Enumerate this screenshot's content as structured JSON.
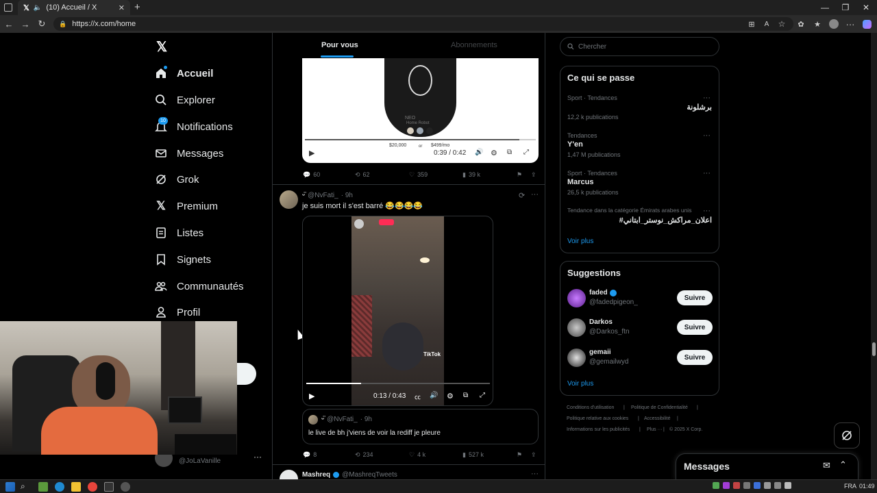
{
  "browser": {
    "tab_title": "(10) Accueil / X",
    "url": "https://x.com/home"
  },
  "sidebar": {
    "items": [
      {
        "label": "Accueil",
        "icon": "home-icon"
      },
      {
        "label": "Explorer",
        "icon": "search-icon"
      },
      {
        "label": "Notifications",
        "icon": "bell-icon",
        "badge": "10"
      },
      {
        "label": "Messages",
        "icon": "mail-icon"
      },
      {
        "label": "Grok",
        "icon": "grok-icon"
      },
      {
        "label": "Premium",
        "icon": "x-logo-icon"
      },
      {
        "label": "Listes",
        "icon": "list-icon"
      },
      {
        "label": "Signets",
        "icon": "bookmark-icon"
      },
      {
        "label": "Communautés",
        "icon": "communities-icon"
      },
      {
        "label": "Profil",
        "icon": "person-icon"
      }
    ],
    "account_handle": "@JoLaVanille"
  },
  "feed": {
    "tabs": [
      "Pour vous",
      "Abonnements"
    ],
    "post1": {
      "video_time": "0:39 / 0:42",
      "media_text": {
        "brand": "NEO",
        "subtitle": "Home Robot",
        "price1": "$20,000",
        "or": "or",
        "price2": "$499/mo"
      },
      "replies": "60",
      "reposts": "62",
      "likes": "359",
      "views": "39 k"
    },
    "post2": {
      "handle": "@NvFati_",
      "time": "· 9h",
      "text": "je suis mort il s'est barré 😂😂😂😂",
      "video_time": "0:13 / 0:43",
      "tiktok_label": "TikTok",
      "quote": {
        "handle": "@NvFati_",
        "time": "· 9h",
        "text": "le live de bh j'viens de voir la rediff je pleure"
      },
      "replies": "8",
      "reposts": "234",
      "likes": "4 k",
      "views": "527 k"
    },
    "post3": {
      "name": "Mashreq",
      "handle": "@MashreqTweets"
    }
  },
  "right": {
    "search_placeholder": "Chercher",
    "trends_title": "Ce qui se passe",
    "trends": [
      {
        "meta": "Sport · Tendances",
        "title": "برشلونة",
        "count": "12,2 k publications"
      },
      {
        "meta": "Tendances",
        "title": "Y'en",
        "count": "1,47 M publications"
      },
      {
        "meta": "Sport · Tendances",
        "title": "Marcus",
        "count": "26,5 k publications"
      },
      {
        "meta": "Tendance dans la catégorie Émirats arabes unis",
        "title": "#اعلان_مراكش_نوستر_ابتاني",
        "count": ""
      }
    ],
    "trends_more": "Voir plus",
    "suggestions_title": "Suggestions",
    "suggestions": [
      {
        "name": "faded",
        "handle": "@fadedpigeon_",
        "verified": true,
        "button": "Suivre"
      },
      {
        "name": "Darkos",
        "handle": "@Darkos_ftn",
        "verified": false,
        "button": "Suivre"
      },
      {
        "name": "gemaii",
        "handle": "@gemailwyd",
        "verified": false,
        "button": "Suivre"
      }
    ],
    "suggestions_more": "Voir plus",
    "footer": {
      "terms": "Conditions d'utilisation",
      "privacy": "Politique de Confidentialité",
      "cookies": "Politique relative aux cookies",
      "accessibility": "Accessibilité",
      "ads": "Informations sur les publicités",
      "more": "Plus ···",
      "copyright": "© 2025 X Corp."
    },
    "messages_drawer": "Messages"
  },
  "taskbar": {
    "lang": "FRA",
    "time": "01:49"
  },
  "colors": {
    "accent": "#1d9bf0",
    "background": "#000000",
    "border": "#2f3336",
    "muted": "#71767b",
    "like_red": "#f91880"
  }
}
